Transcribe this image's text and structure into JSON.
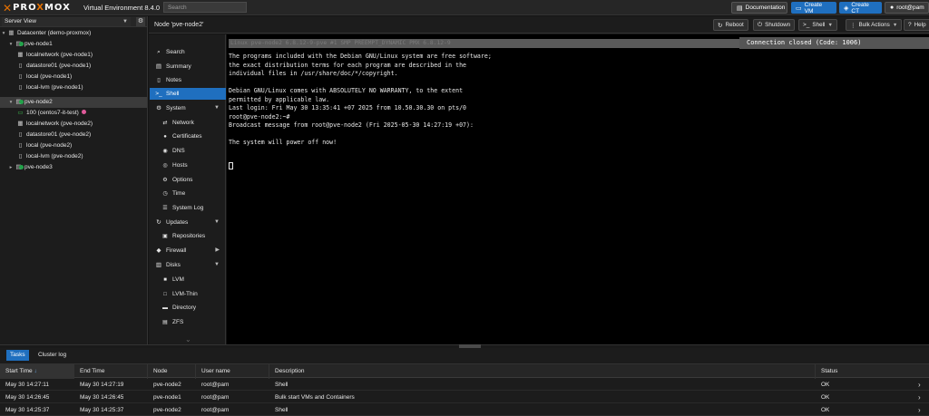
{
  "topbar": {
    "logo_x": "✕",
    "logo_pre": "PRO",
    "logo_x2": "X",
    "logo_post": "MOX",
    "version": "Virtual Environment 8.4.0",
    "search_placeholder": "Search",
    "doc_label": "Documentation",
    "create_vm_label": "Create VM",
    "create_ct_label": "Create CT",
    "user_label": "root@pam"
  },
  "tree": {
    "view": "Server View",
    "rows": [
      {
        "label": "Datacenter (demo-proxmox)",
        "icon": "datacenter-icon"
      },
      {
        "label": "pve-node1",
        "icon": "server-icon"
      },
      {
        "label": "localnetwork (pve-node1)",
        "icon": "network-icon"
      },
      {
        "label": "datastore01 (pve-node1)",
        "icon": "storage-icon"
      },
      {
        "label": "local (pve-node1)",
        "icon": "storage-icon"
      },
      {
        "label": "local-lvm (pve-node1)",
        "icon": "storage-icon"
      },
      {
        "label": "pve-node2",
        "icon": "server-icon"
      },
      {
        "label": "100 (centos7-it-test)",
        "icon": "vm-icon"
      },
      {
        "label": "localnetwork (pve-node2)",
        "icon": "network-icon"
      },
      {
        "label": "datastore01 (pve-node2)",
        "icon": "storage-icon"
      },
      {
        "label": "local (pve-node2)",
        "icon": "storage-icon"
      },
      {
        "label": "local-lvm (pve-node2)",
        "icon": "storage-icon"
      },
      {
        "label": "pve-node3",
        "icon": "server-icon"
      }
    ]
  },
  "node": {
    "title": "Node 'pve-node2'",
    "reboot_label": "Reboot",
    "shutdown_label": "Shutdown",
    "shell_label": "Shell",
    "bulk_label": "Bulk Actions",
    "help_label": "Help"
  },
  "nav": {
    "items": [
      {
        "label": "Search",
        "icon": "search-icon"
      },
      {
        "label": "Summary",
        "icon": "summary-icon"
      },
      {
        "label": "Notes",
        "icon": "notes-icon"
      },
      {
        "label": "Shell",
        "icon": "terminal-icon"
      },
      {
        "label": "System",
        "icon": "gear-icon"
      },
      {
        "label": "Network",
        "icon": "network-icon"
      },
      {
        "label": "Certificates",
        "icon": "certificate-icon"
      },
      {
        "label": "DNS",
        "icon": "globe-icon"
      },
      {
        "label": "Hosts",
        "icon": "hosts-icon"
      },
      {
        "label": "Options",
        "icon": "options-icon"
      },
      {
        "label": "Time",
        "icon": "clock-icon"
      },
      {
        "label": "System Log",
        "icon": "list-icon"
      },
      {
        "label": "Updates",
        "icon": "refresh-icon"
      },
      {
        "label": "Repositories",
        "icon": "repository-icon"
      },
      {
        "label": "Firewall",
        "icon": "shield-icon"
      },
      {
        "label": "Disks",
        "icon": "disk-icon"
      },
      {
        "label": "LVM",
        "icon": "lvm-icon"
      },
      {
        "label": "LVM-Thin",
        "icon": "square-icon"
      },
      {
        "label": "Directory",
        "icon": "folder-icon"
      },
      {
        "label": "ZFS",
        "icon": "zfs-icon"
      }
    ]
  },
  "terminal": {
    "first_line": "Linux pve-node2 6.8.12-9-pve #1 SMP PREEMPT_DYNAMIC PMX 6.8.12-9",
    "connection_msg": "Connection closed (Code: 1006)",
    "lines": [
      "",
      "The programs included with the Debian GNU/Linux system are free software;",
      "the exact distribution terms for each program are described in the",
      "individual files in /usr/share/doc/*/copyright.",
      "",
      "Debian GNU/Linux comes with ABSOLUTELY NO WARRANTY, to the extent",
      "permitted by applicable law.",
      "Last login: Fri May 30 13:35:41 +07 2025 from 10.50.30.30 on pts/0",
      "root@pve-node2:~#",
      "Broadcast message from root@pve-node2 (Fri 2025-05-30 14:27:19 +07):",
      "",
      "The system will power off now!"
    ]
  },
  "log": {
    "tabs": [
      "Tasks",
      "Cluster log"
    ],
    "headers": [
      "Start Time",
      "End Time",
      "Node",
      "User name",
      "Description",
      "Status"
    ],
    "sort_indicator": "↓",
    "rows": [
      {
        "start": "May 30 14:27:11",
        "end": "May 30 14:27:19",
        "node": "pve-node2",
        "user": "root@pam",
        "desc": "Shell",
        "status": "OK"
      },
      {
        "start": "May 30 14:26:45",
        "end": "May 30 14:26:45",
        "node": "pve-node1",
        "user": "root@pam",
        "desc": "Bulk start VMs and Containers",
        "status": "OK"
      },
      {
        "start": "May 30 14:25:37",
        "end": "May 30 14:25:37",
        "node": "pve-node2",
        "user": "root@pam",
        "desc": "Shell",
        "status": "OK"
      }
    ]
  },
  "colors": {
    "accent": "#1f6fbf",
    "brand": "#e57000",
    "ok": "#22a34a"
  }
}
